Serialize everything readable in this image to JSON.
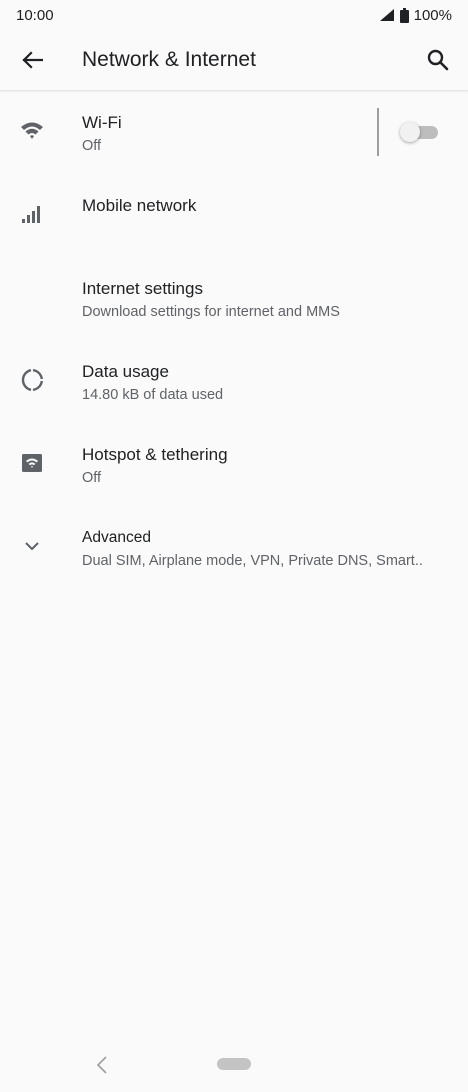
{
  "status_bar": {
    "time": "10:00",
    "battery": "100%",
    "icons": [
      "cell-signal-icon",
      "battery-icon"
    ]
  },
  "app_bar": {
    "title": "Network & Internet",
    "back_icon": "arrow-back-icon",
    "search_icon": "search-icon"
  },
  "settings": [
    {
      "icon": "wifi-icon",
      "title": "Wi-Fi",
      "subtitle": "Off",
      "toggle_on": false
    },
    {
      "icon": "cell-signal-icon",
      "title": "Mobile network",
      "subtitle": ""
    },
    {
      "icon": "",
      "title": "Internet settings",
      "subtitle": "Download settings for internet and MMS"
    },
    {
      "icon": "data-usage-icon",
      "title": "Data usage",
      "subtitle": "14.80 kB of data used"
    },
    {
      "icon": "hotspot-icon",
      "title": "Hotspot & tethering",
      "subtitle": "Off"
    },
    {
      "icon": "chevron-down-icon",
      "title": "Advanced",
      "subtitle": "Dual SIM, Airplane mode, VPN, Private DNS, Smart.."
    }
  ],
  "nav_bar": {
    "back_icon": "nav-back-icon",
    "home_icon": "nav-home-pill"
  },
  "colors": {
    "background": "#fafafa",
    "icon": "#5f6368",
    "text_primary": "#202124",
    "text_secondary": "#5f6368"
  }
}
